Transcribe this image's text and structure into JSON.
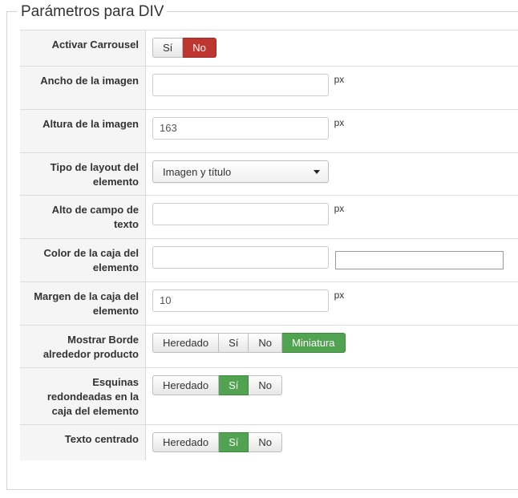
{
  "legend": "Parámetros para DIV",
  "rows": [
    {
      "label": "Activar Carrousel",
      "options": [
        "Sí",
        "No"
      ],
      "selected": "No"
    },
    {
      "label": "Ancho de la imagen",
      "value": "",
      "suffix": "px"
    },
    {
      "label": "Altura de la imagen",
      "value": "163",
      "suffix": "px"
    },
    {
      "label": "Tipo de layout del elemento",
      "select_value": "Imagen y título"
    },
    {
      "label": "Alto de campo de texto",
      "value": "",
      "suffix": "px"
    },
    {
      "label": "Color de la caja del elemento",
      "value": ""
    },
    {
      "label": "Margen de la caja del elemento",
      "value": "10",
      "suffix": "px"
    },
    {
      "label": "Mostrar Borde alrededor producto",
      "options": [
        "Heredado",
        "Sí",
        "No",
        "Miniatura"
      ],
      "selected": "Miniatura"
    },
    {
      "label": "Esquinas redondeadas en la caja del elemento",
      "options": [
        "Heredado",
        "Sí",
        "No"
      ],
      "selected": "Sí"
    },
    {
      "label": "Texto centrado",
      "options": [
        "Heredado",
        "Sí",
        "No"
      ],
      "selected": "Sí"
    }
  ],
  "colors": {
    "red_active": "#bd362f",
    "green_active": "#51a351"
  }
}
